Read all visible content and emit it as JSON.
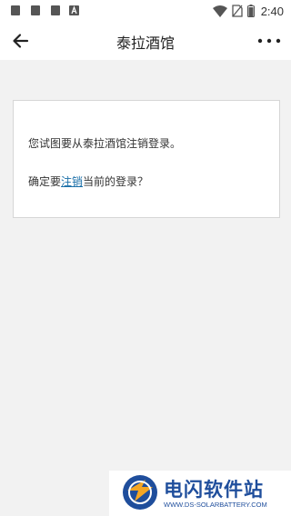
{
  "status_bar": {
    "time": "2:40",
    "icons": [
      "notification-icon",
      "notification-icon",
      "notification-icon",
      "app-icon",
      "wifi-icon",
      "no-sim-icon",
      "battery-icon"
    ]
  },
  "app_bar": {
    "title": "泰拉酒馆",
    "back_icon": "arrow-left-icon",
    "more_icon": "more-horizontal-icon"
  },
  "dialog": {
    "line1": "您试图要从泰拉酒馆注销登录。",
    "line2_prefix": "确定要",
    "line2_link": "注销",
    "line2_suffix": "当前的登录？"
  },
  "watermark": {
    "name": "电闪软件站",
    "url": "WWW.DS-SOLARBATTERY.COM"
  },
  "colors": {
    "background": "#f2f2f2",
    "link": "#1a6fa8",
    "watermark_blue": "#1f4e9c",
    "watermark_orange": "#f5a623"
  }
}
